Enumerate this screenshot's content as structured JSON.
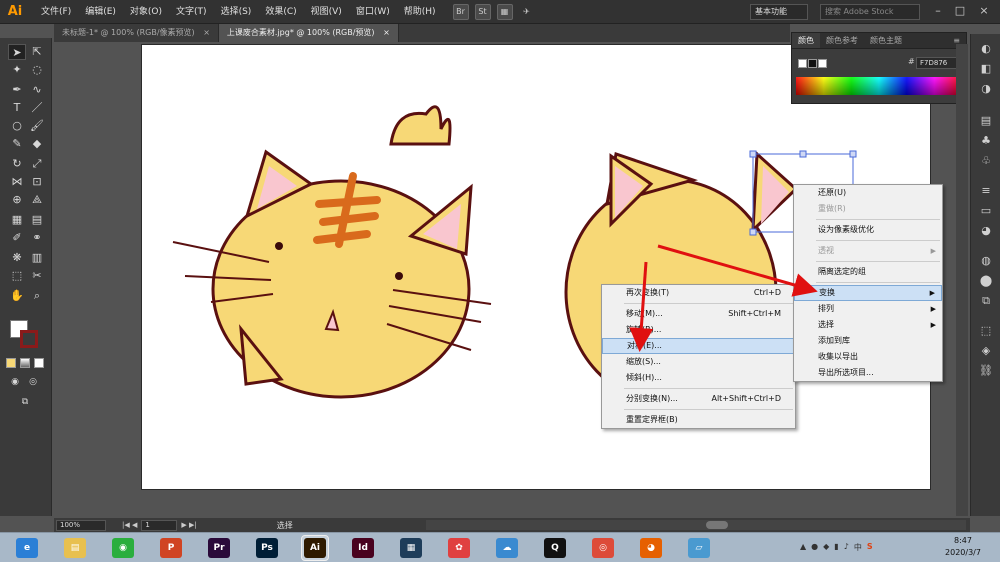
{
  "app": {
    "logo": "Ai",
    "accent": "#ff9a00"
  },
  "menubar": {
    "items": [
      "文件(F)",
      "编辑(E)",
      "对象(O)",
      "文字(T)",
      "选择(S)",
      "效果(C)",
      "视图(V)",
      "窗口(W)",
      "帮助(H)"
    ],
    "workspace": "基本功能",
    "search_placeholder": "搜索 Adobe Stock"
  },
  "doc_tabs": [
    {
      "label": "未标题-1* @ 100% (RGB/像素预览)",
      "close": "×"
    },
    {
      "label": "上课废合素材.jpg* @ 100% (RGB/预览)",
      "close": "×"
    }
  ],
  "color_panel": {
    "tabs": [
      "颜色",
      "颜色参考",
      "颜色主题"
    ],
    "hex_label": "#",
    "hex_value": "F7D876"
  },
  "status": {
    "zoom": "100%",
    "page": "1",
    "tool": "选择"
  },
  "context_menu": {
    "items": [
      {
        "label": "还原(U)",
        "disabled": false
      },
      {
        "label": "重做(R)",
        "disabled": true
      },
      {
        "sep": true
      },
      {
        "label": "设为像素级优化",
        "disabled": false
      },
      {
        "sep": true
      },
      {
        "label": "透视",
        "disabled": true,
        "submenu": true
      },
      {
        "sep": true
      },
      {
        "label": "隔离选定的组",
        "disabled": false
      },
      {
        "sep": true
      },
      {
        "label": "变换",
        "disabled": false,
        "submenu": true,
        "hover": true
      },
      {
        "label": "排列",
        "disabled": false,
        "submenu": true
      },
      {
        "label": "选择",
        "disabled": false,
        "submenu": true
      },
      {
        "label": "添加到库",
        "disabled": false
      },
      {
        "label": "收集以导出",
        "disabled": false
      },
      {
        "label": "导出所选项目...",
        "disabled": false
      }
    ]
  },
  "transform_submenu": {
    "items": [
      {
        "label": "再次变换(T)",
        "shortcut": "Ctrl+D"
      },
      {
        "sep": true
      },
      {
        "label": "移动(M)...",
        "shortcut": "Shift+Ctrl+M"
      },
      {
        "label": "旋转(R)...",
        "shortcut": ""
      },
      {
        "label": "对称(E)...",
        "shortcut": "",
        "hover": true
      },
      {
        "label": "缩放(S)...",
        "shortcut": ""
      },
      {
        "label": "倾斜(H)...",
        "shortcut": ""
      },
      {
        "sep": true
      },
      {
        "label": "分别变换(N)...",
        "shortcut": "Alt+Shift+Ctrl+D"
      },
      {
        "sep": true
      },
      {
        "label": "重置定界框(B)",
        "shortcut": ""
      }
    ]
  },
  "taskbar": {
    "apps": [
      {
        "name": "browser-app",
        "glyph": "e",
        "color": "#2b7fd6"
      },
      {
        "name": "explorer-app",
        "glyph": "▤",
        "color": "#e8c050"
      },
      {
        "name": "wechat-app",
        "glyph": "◉",
        "color": "#2aae3d"
      },
      {
        "name": "powerpoint-app",
        "glyph": "P",
        "color": "#d04423"
      },
      {
        "name": "premiere-app",
        "glyph": "Pr",
        "color": "#2a0a3a"
      },
      {
        "name": "photoshop-app",
        "glyph": "Ps",
        "color": "#001e36"
      },
      {
        "name": "illustrator-app",
        "glyph": "Ai",
        "color": "#2e1a00",
        "active": true
      },
      {
        "name": "indesign-app",
        "glyph": "Id",
        "color": "#49021f"
      },
      {
        "name": "video-app",
        "glyph": "▦",
        "color": "#1e3d5a"
      },
      {
        "name": "photos-app",
        "glyph": "✿",
        "color": "#e04040"
      },
      {
        "name": "network-app",
        "glyph": "☁",
        "color": "#3a8ad0"
      },
      {
        "name": "qq-app",
        "glyph": "Q",
        "color": "#111111"
      },
      {
        "name": "chrome-app",
        "glyph": "◎",
        "color": "#dd4b39"
      },
      {
        "name": "firefox-app",
        "glyph": "◕",
        "color": "#e66000"
      },
      {
        "name": "notes-app",
        "glyph": "▱",
        "color": "#4a9ad0"
      }
    ],
    "time": "8:47",
    "date": "2020/3/7"
  }
}
